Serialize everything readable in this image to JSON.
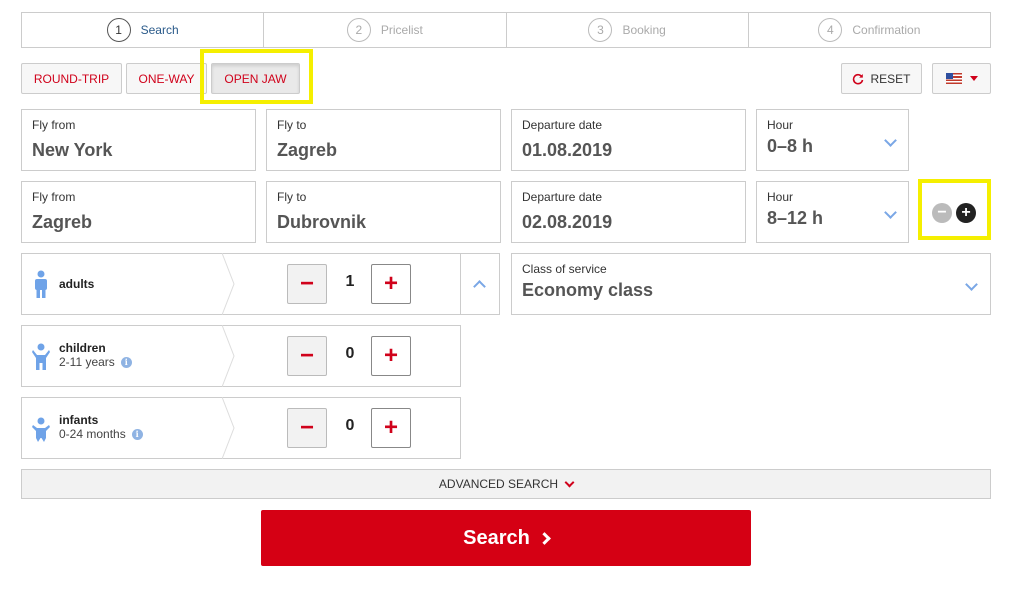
{
  "steps": [
    {
      "num": "1",
      "label": "Search",
      "active": true
    },
    {
      "num": "2",
      "label": "Pricelist",
      "active": false
    },
    {
      "num": "3",
      "label": "Booking",
      "active": false
    },
    {
      "num": "4",
      "label": "Confirmation",
      "active": false
    }
  ],
  "trip_types": {
    "round_trip": "ROUND-TRIP",
    "one_way": "ONE-WAY",
    "open_jaw": "OPEN JAW",
    "selected": "OPEN JAW"
  },
  "reset_label": "RESET",
  "language": {
    "flag": "us-flag-icon"
  },
  "segments": [
    {
      "from_label": "Fly from",
      "from": "New York",
      "to_label": "Fly to",
      "to": "Zagreb",
      "date_label": "Departure date",
      "date": "01.08.2019",
      "hour_label": "Hour",
      "hour": "0–8 h"
    },
    {
      "from_label": "Fly from",
      "from": "Zagreb",
      "to_label": "Fly to",
      "to": "Dubrovnik",
      "date_label": "Departure date",
      "date": "02.08.2019",
      "hour_label": "Hour",
      "hour": "8–12 h"
    }
  ],
  "passengers": {
    "adults": {
      "label": "adults",
      "count": "1"
    },
    "children": {
      "label": "children",
      "sub": "2-11 years",
      "count": "0"
    },
    "infants": {
      "label": "infants",
      "sub": "0-24 months",
      "count": "0"
    }
  },
  "class_of_service": {
    "label": "Class of service",
    "value": "Economy class"
  },
  "advanced_search": "ADVANCED SEARCH",
  "search_button": "Search",
  "colors": {
    "brand_red": "#d50014",
    "highlight": "#f5ef00",
    "accent_blue": "#7aa7e6"
  }
}
